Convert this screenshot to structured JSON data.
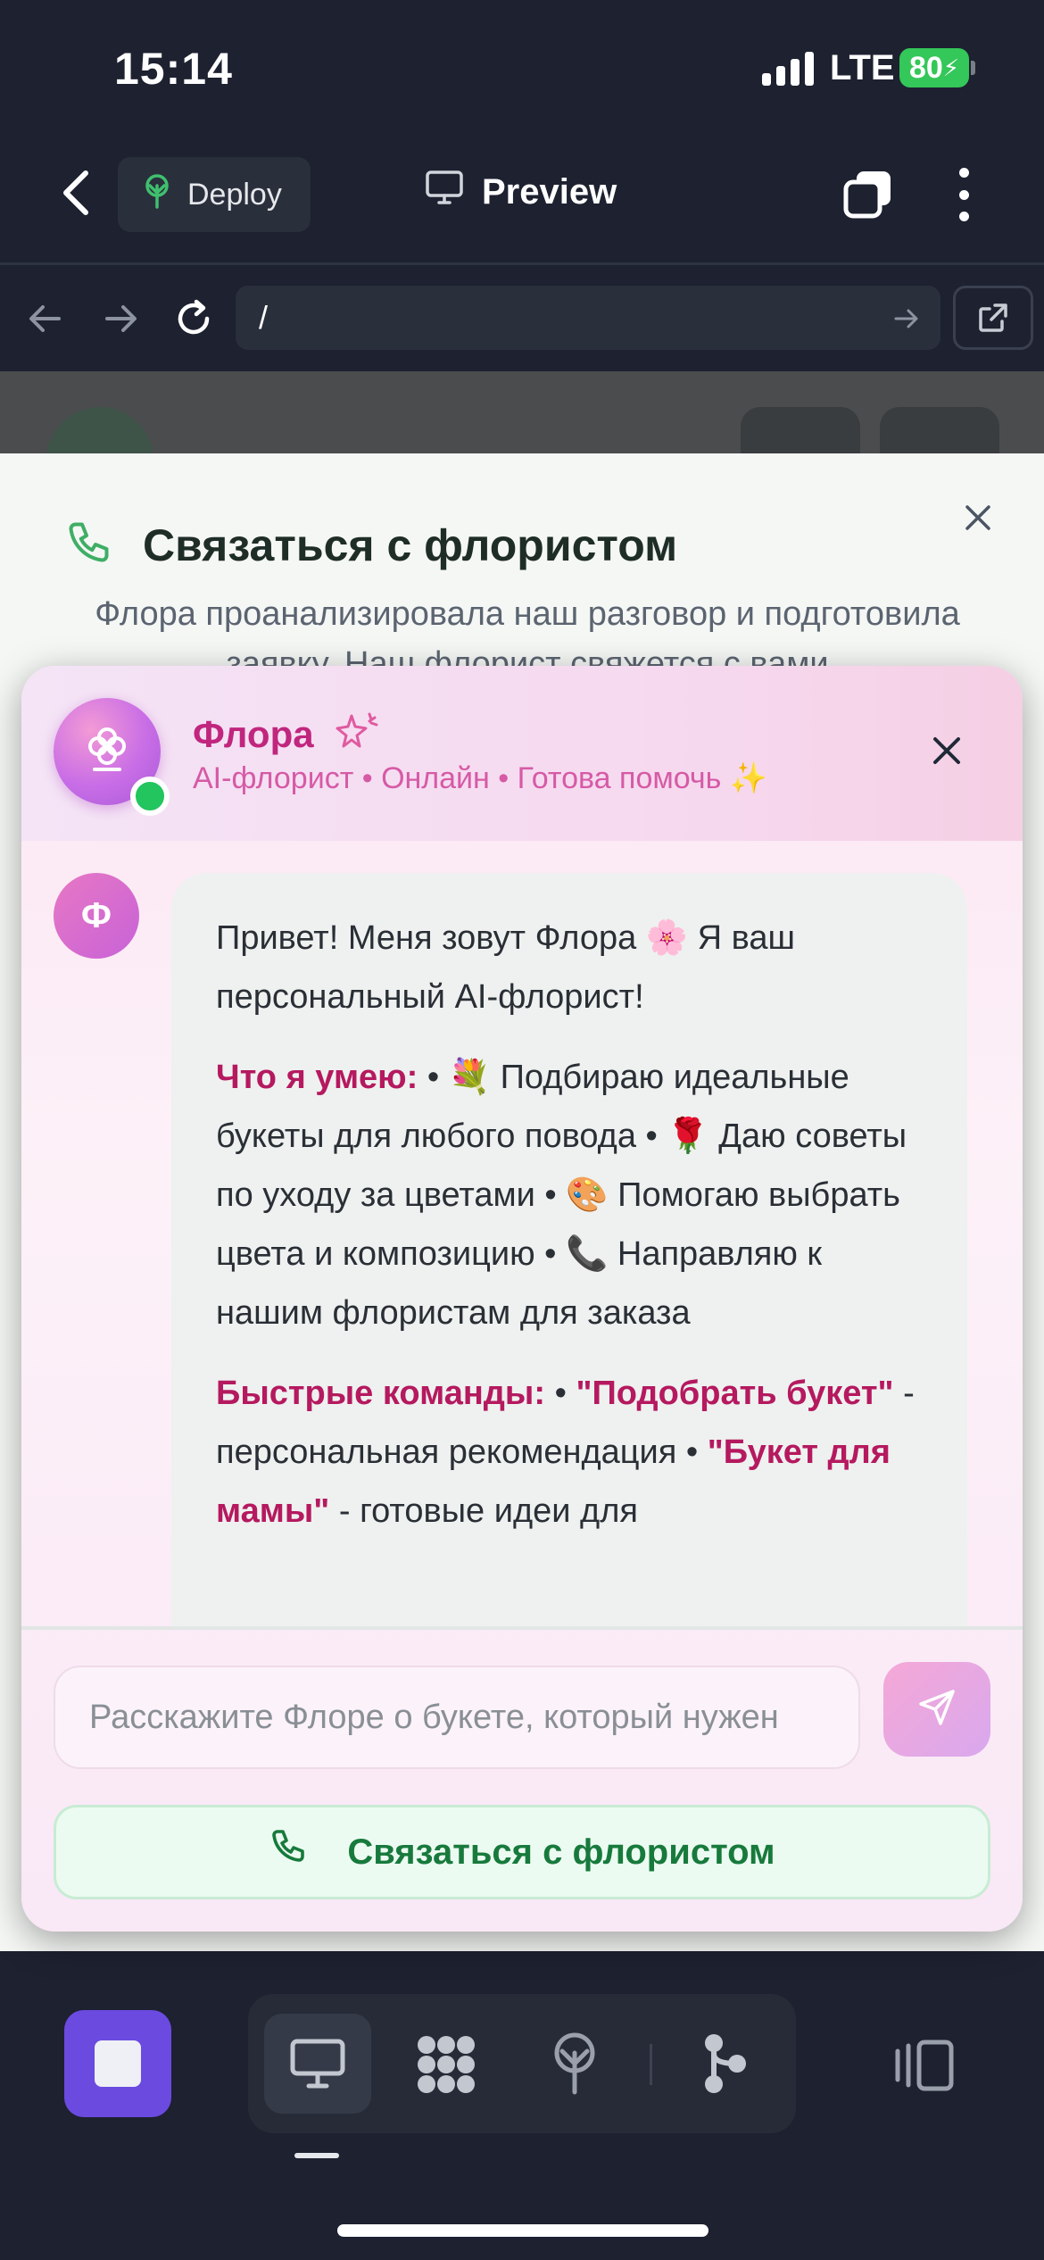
{
  "status_bar": {
    "time": "15:14",
    "network": "LTE",
    "battery": "80"
  },
  "app_bar": {
    "deploy_label": "Deploy",
    "preview_label": "Preview"
  },
  "url_bar": {
    "url": "/"
  },
  "contact_sheet": {
    "title": "Связаться с флористом",
    "description": "Флора проанализировала наш разговор и подготовила заявку. Наш флорист свяжется с вами"
  },
  "chat": {
    "bot_name": "Флора",
    "bot_subtitle": "AI-флорист • Онлайн • Готова помочь ✨",
    "avatar_letter": "Ф",
    "message": {
      "greeting": "Привет! Меня зовут Флора 🌸 Я ваш персональный AI-флорист!",
      "skills_heading": "Что я умею:",
      "skills_text": " • 💐 Подбираю идеальные букеты для любого повода • 🌹 Даю советы по уходу за цветами • 🎨 Помогаю выбрать цвета и композицию • 📞 Направляю к нашим флористам для заказа",
      "commands_heading": "Быстрые команды:",
      "commands_sep": " • ",
      "cmd1": "\"Подобрать букет\"",
      "cmd1_desc": " - персональная рекомендация • ",
      "cmd2": "\"Букет для мамы\"",
      "cmd2_desc": " - готовые идеи для"
    },
    "input_placeholder": "Расскажите Флоре о букете, который нужен",
    "contact_button": "Связаться с флористом"
  },
  "colors": {
    "accent": "#6b4ae0",
    "brand_pink": "#c0267e",
    "online": "#22c55e",
    "contact_green": "#177a3c"
  },
  "icons": [
    "back-icon",
    "sprout-icon",
    "monitor-icon",
    "tabs-icon",
    "more-icon",
    "arrow-left-icon",
    "arrow-right-icon",
    "reload-icon",
    "external-link-icon",
    "phone-icon",
    "close-icon",
    "flower-icon",
    "sparkle-icon",
    "send-icon",
    "stop-icon",
    "apps-icon",
    "deploy-icon",
    "branch-icon",
    "panel-icon"
  ]
}
